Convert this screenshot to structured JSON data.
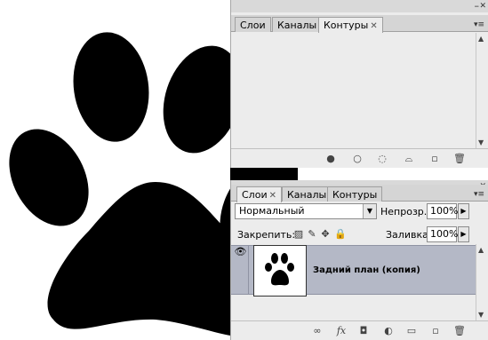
{
  "paths_panel": {
    "tabs": [
      {
        "label": "Слои",
        "active": false
      },
      {
        "label": "Каналы",
        "active": false
      },
      {
        "label": "Контуры",
        "active": true,
        "closable": true
      }
    ],
    "bottom_icons": [
      "fill-path-icon",
      "stroke-path-icon",
      "load-selection-icon",
      "make-work-path-icon",
      "new-path-icon",
      "delete-path-icon"
    ]
  },
  "layers_panel": {
    "tabs": [
      {
        "label": "Слои",
        "active": true,
        "closable": true
      },
      {
        "label": "Каналы",
        "active": false
      },
      {
        "label": "Контуры",
        "active": false
      }
    ],
    "blend_mode": "Нормальный",
    "opacity_label": "Непрозр.:",
    "opacity_value": "100%",
    "lock_label": "Закрепить:",
    "fill_label": "Заливка:",
    "fill_value": "100%",
    "layers": [
      {
        "name": "Задний план (копия)",
        "visible": true,
        "selected": true
      }
    ],
    "bottom_icons": [
      "link-icon",
      "fx-icon",
      "mask-icon",
      "adjustment-icon",
      "group-icon",
      "new-layer-icon",
      "trash-icon"
    ],
    "fx_label": "fx"
  },
  "colors": {
    "panel_bg": "#ececec",
    "selected_row": "#b4b8c6",
    "paw": "#000000"
  }
}
